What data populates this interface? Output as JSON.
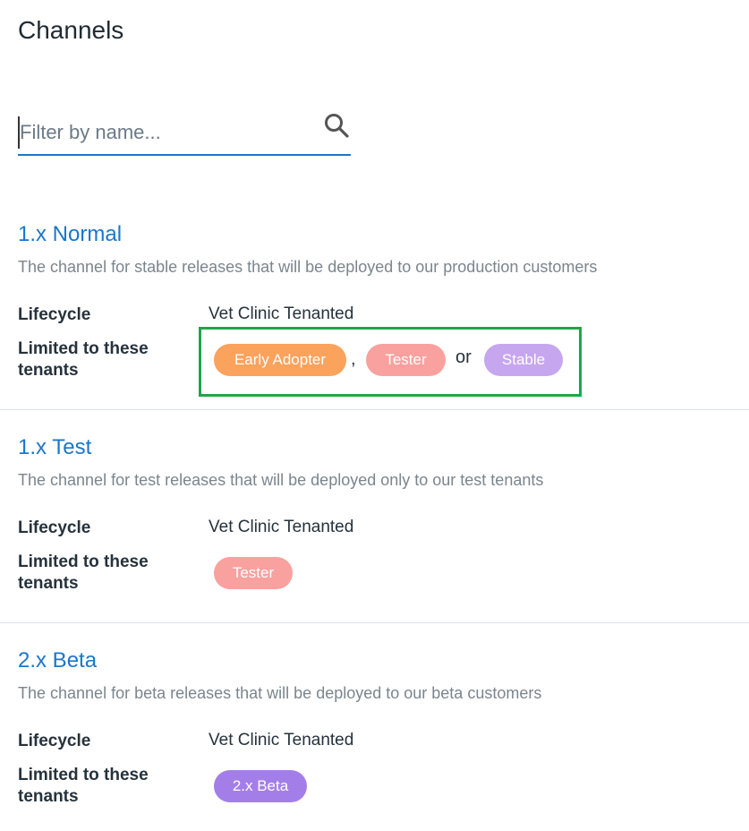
{
  "page": {
    "title": "Channels"
  },
  "filter": {
    "placeholder": "Filter by name..."
  },
  "labels": {
    "lifecycle": "Lifecycle",
    "limited_line1": "Limited to these",
    "limited_line2": "tenants"
  },
  "separators": {
    "comma": ",",
    "or": "or"
  },
  "channels": [
    {
      "name": "1.x Normal",
      "description": "The channel for stable releases that will be deployed to our production customers",
      "lifecycle": "Vet Clinic Tenanted",
      "tags": [
        "Early Adopter",
        "Tester",
        "Stable"
      ]
    },
    {
      "name": "1.x Test",
      "description": "The channel for test releases that will be deployed only to our test tenants",
      "lifecycle": "Vet Clinic Tenanted",
      "tags": [
        "Tester"
      ]
    },
    {
      "name": "2.x Beta",
      "description": "The channel for beta releases that will be deployed to our beta customers",
      "lifecycle": "Vet Clinic Tenanted",
      "tags": [
        "2.x Beta"
      ]
    }
  ],
  "colors": {
    "early_adopter": "#fba25c",
    "tester": "#f9a19f",
    "stable": "#c7a6f0",
    "beta": "#a47ee8",
    "link": "#1a77ca",
    "highlight_border": "#1fa64a"
  }
}
